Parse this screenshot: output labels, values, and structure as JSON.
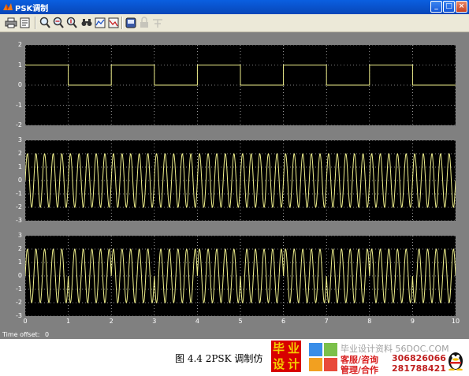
{
  "window": {
    "title": "PSK调制",
    "buttons": {
      "minimize": "_",
      "maximize": "□",
      "close": "×"
    }
  },
  "toolbar": {
    "buttons": [
      {
        "name": "print-icon",
        "enabled": true
      },
      {
        "name": "parameters-icon",
        "enabled": true
      },
      {
        "name": "zoom-icon",
        "enabled": true
      },
      {
        "name": "zoom-x-icon",
        "enabled": true
      },
      {
        "name": "zoom-y-icon",
        "enabled": true
      },
      {
        "name": "autoscale-icon",
        "enabled": true
      },
      {
        "name": "save-axes-icon",
        "enabled": true
      },
      {
        "name": "restore-axes-icon",
        "enabled": true
      },
      {
        "name": "floating-scope-icon",
        "enabled": true
      },
      {
        "name": "lock-axes-icon",
        "enabled": false
      },
      {
        "name": "signal-selection-icon",
        "enabled": false
      }
    ]
  },
  "plots": {
    "x_ticks": [
      "0",
      "1",
      "2",
      "3",
      "4",
      "5",
      "6",
      "7",
      "8",
      "9",
      "10"
    ],
    "panels": [
      {
        "y_ticks": [
          "2",
          "1",
          "0",
          "-1",
          "-2"
        ]
      },
      {
        "y_ticks": [
          "3",
          "2",
          "1",
          "0",
          "-1",
          "-2",
          "-3"
        ]
      },
      {
        "y_ticks": [
          "3",
          "2",
          "1",
          "0",
          "-1",
          "-2",
          "-3"
        ]
      }
    ]
  },
  "chart_data": [
    {
      "type": "line",
      "x": [
        0,
        1,
        1,
        2,
        2,
        3,
        3,
        4,
        4,
        5,
        5,
        6,
        6,
        7,
        7,
        8,
        8,
        9,
        9,
        10
      ],
      "series": [
        {
          "values": [
            1,
            1,
            0,
            0,
            1,
            1,
            0,
            0,
            1,
            1,
            0,
            0,
            1,
            1,
            0,
            0,
            1,
            1,
            0,
            0
          ]
        }
      ],
      "xlim": [
        0,
        10
      ],
      "ylim": [
        -2,
        2
      ],
      "grid": true,
      "color": "#f0f08c"
    },
    {
      "type": "line",
      "function": "sinusoid",
      "amplitude": 2,
      "cycles_per_unit": 5,
      "xlim": [
        0,
        10
      ],
      "ylim": [
        -3,
        3
      ],
      "grid": true,
      "color": "#f0f08c"
    },
    {
      "type": "line",
      "function": "bpsk",
      "amplitude": 2,
      "cycles_per_unit": 5,
      "bits": [
        1,
        0,
        1,
        0,
        1,
        0,
        1,
        0,
        1,
        0
      ],
      "xlim": [
        0,
        10
      ],
      "ylim": [
        -3,
        3
      ],
      "grid": true,
      "color": "#f0f08c"
    }
  ],
  "status": {
    "time_offset_label": "Time offset:",
    "time_offset_value": "0"
  },
  "caption": "图 4.4  2PSK 调制仿",
  "ad": {
    "logo_chars": [
      "毕",
      "业",
      "设",
      "计"
    ],
    "line1": "毕业设计资料 56DOC.COM",
    "line2": "客服/咨询",
    "line3": "管理/合作",
    "phone1": "306826066",
    "phone2": "281788421"
  },
  "colors": {
    "trace": "#f0f08c",
    "plot_bg": "#000000",
    "window_bg": "#808080",
    "grid": "#ffffff"
  }
}
